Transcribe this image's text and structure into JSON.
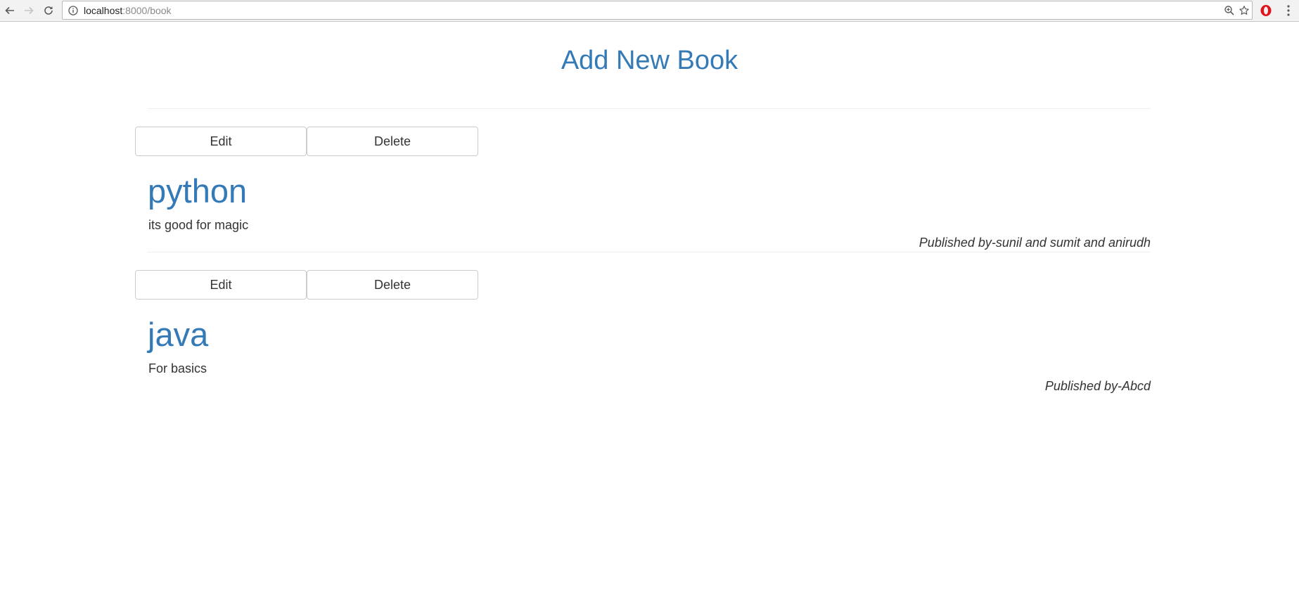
{
  "browser": {
    "url_host": "localhost",
    "url_path": ":8000/book"
  },
  "page": {
    "title": "Add New Book"
  },
  "books": [
    {
      "edit_label": "Edit",
      "delete_label": "Delete",
      "title": "python",
      "description": "its good for magic",
      "published": "Published by-sunil and sumit and anirudh"
    },
    {
      "edit_label": "Edit",
      "delete_label": "Delete",
      "title": "java",
      "description": "For basics",
      "published": "Published by-Abcd"
    }
  ],
  "colors": {
    "link": "#337ab7",
    "text": "#333333",
    "opera_red": "#e0141d"
  },
  "icons": [
    "back-arrow-icon",
    "forward-arrow-icon",
    "reload-icon",
    "info-icon",
    "zoom-icon",
    "star-icon",
    "opera-icon",
    "menu-dots-icon"
  ]
}
